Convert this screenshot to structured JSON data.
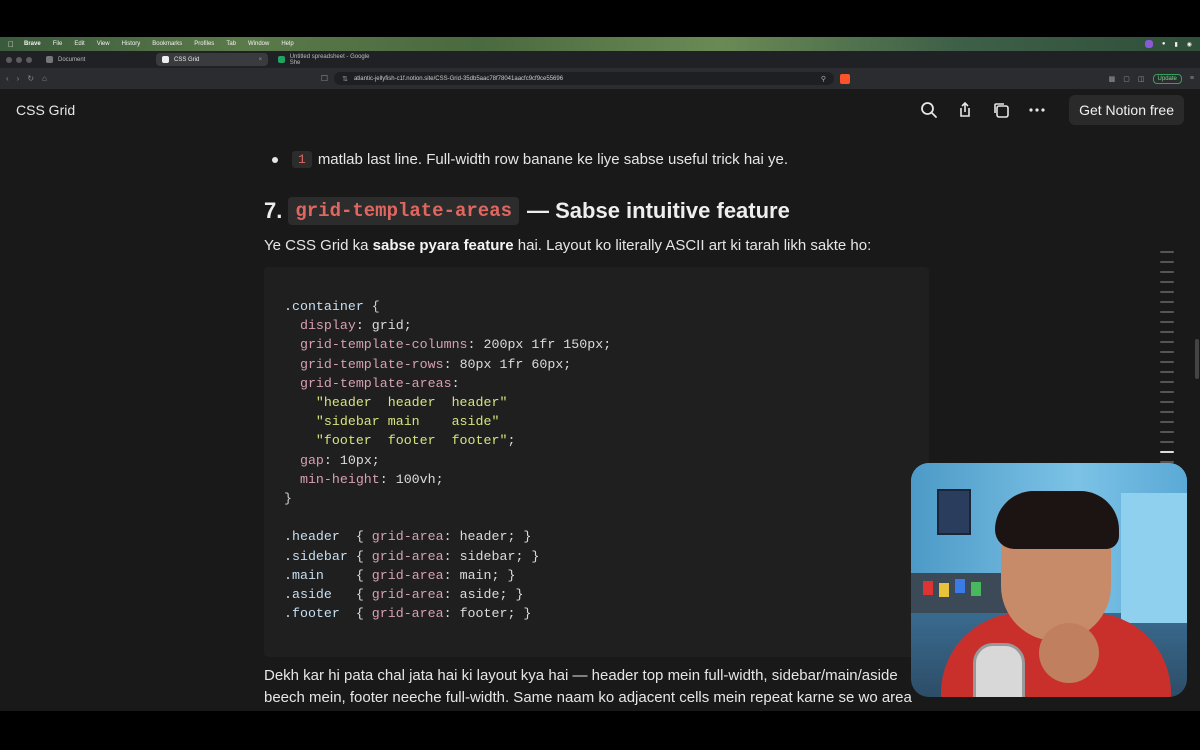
{
  "menubar": {
    "app": "Brave",
    "items": [
      "File",
      "Edit",
      "View",
      "History",
      "Bookmarks",
      "Profiles",
      "Tab",
      "Window",
      "Help"
    ]
  },
  "tabs": [
    {
      "label": "Document",
      "active": false
    },
    {
      "label": "CSS Grid",
      "active": true
    },
    {
      "label": "Untitled spreadsheet - Google She",
      "active": false
    }
  ],
  "address": {
    "url": "atlantic-jellyfish-c1f.notion.site/CSS-Grid-35db5aac78f78041aacfc9cf9ce55696",
    "update_label": "Update"
  },
  "notion": {
    "page_title": "CSS Grid",
    "cta_label": "Get Notion free"
  },
  "content": {
    "bullet_code": "1",
    "bullet_text": "matlab last line. Full-width row banane ke liye sabse useful trick hai ye.",
    "heading_number": "7.",
    "heading_code": "grid-template-areas",
    "heading_rest": "— Sabse intuitive feature",
    "para1_a": "Ye CSS Grid ka ",
    "para1_bold": "sabse pyara feature",
    "para1_b": " hai. Layout ko literally ASCII art ki tarah likh sakte ho:",
    "para2": "Dekh kar hi pata chal jata hai ki layout kya hai — header top mein full-width, sidebar/main/aside beech mein, footer neeche full-width. Same naam ko adjacent cells mein repeat karne se wo area"
  },
  "colors": {
    "page_bg": "#191919",
    "code_bg": "#1f1f1f",
    "inline_code": "#e0675f",
    "accent_update": "#2fa35a"
  },
  "icons": [
    "search-icon",
    "share-icon",
    "duplicate-icon",
    "more-icon"
  ]
}
